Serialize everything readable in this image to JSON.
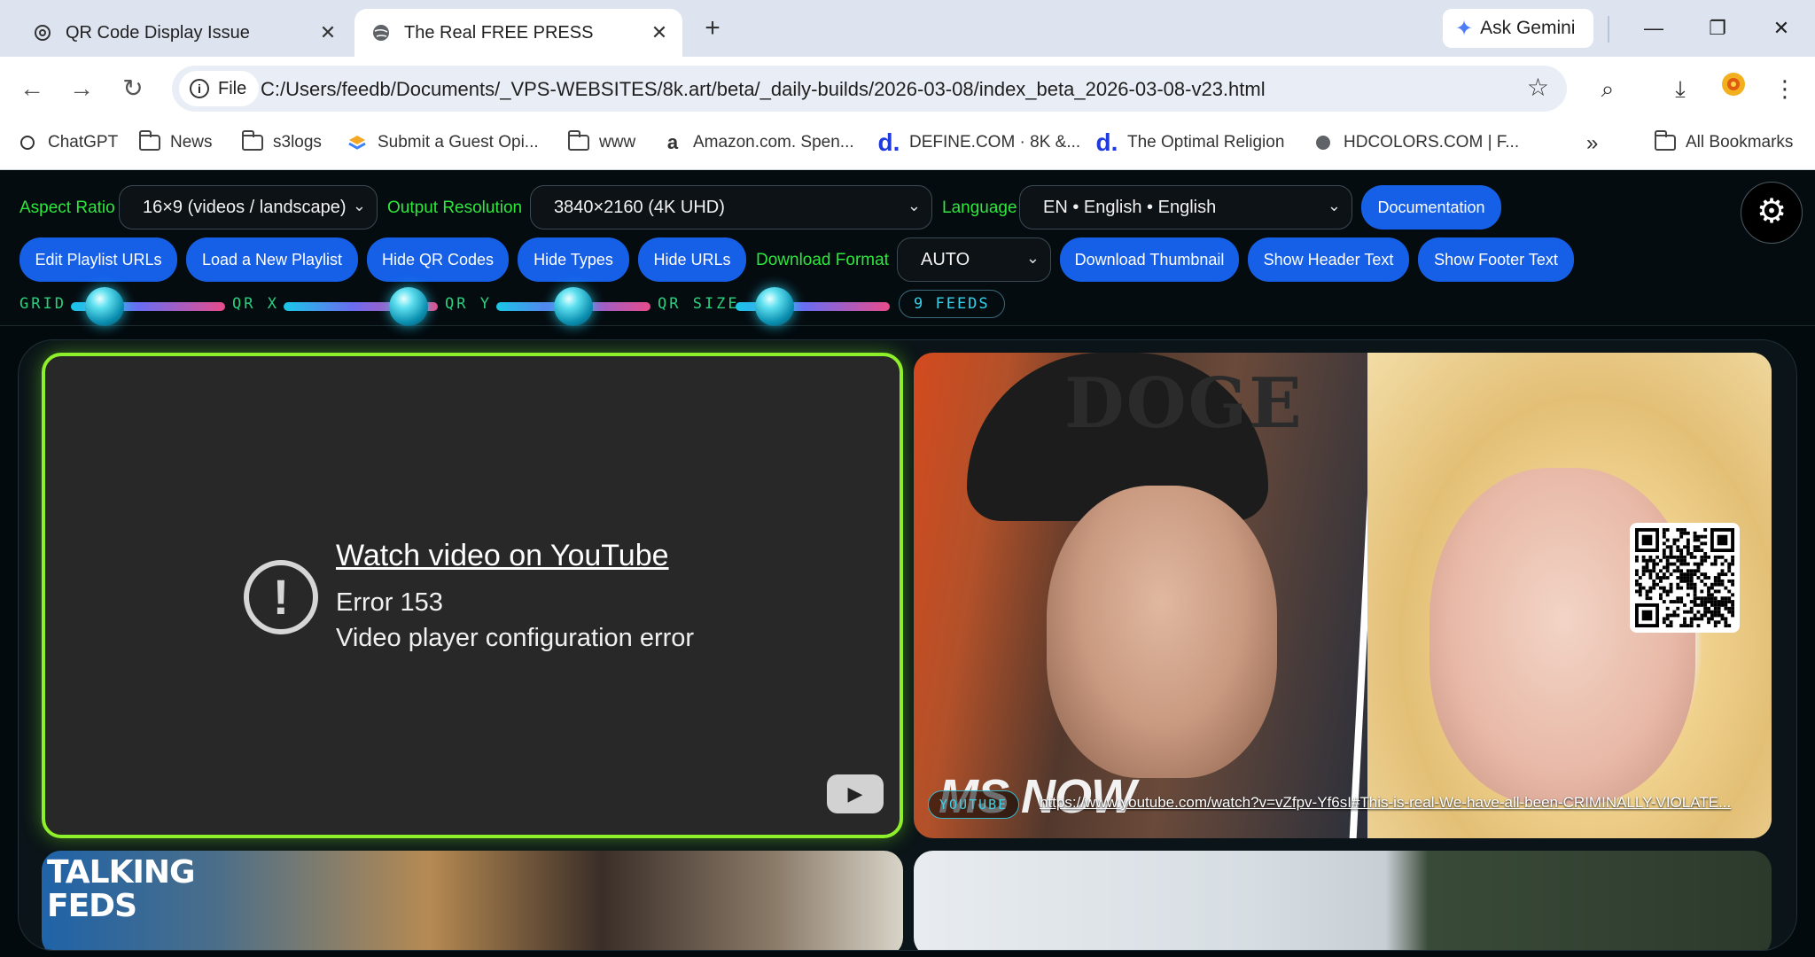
{
  "browser": {
    "tabs": [
      {
        "title": "QR Code Display Issue",
        "icon": "chatgpt-icon",
        "active": false
      },
      {
        "title": "The Real FREE PRESS",
        "icon": "globe-icon",
        "active": true
      }
    ],
    "new_tab_label": "+",
    "ask_gemini_label": "Ask Gemini",
    "url_chip_label": "File",
    "url": "C:/Users/feedb/Documents/_VPS-WEBSITES/8k.art/beta/_daily-builds/2026-03-08/index_beta_2026-03-08-v23.html",
    "bookmarks": [
      {
        "label": "ChatGPT",
        "icon": "chatgpt-icon"
      },
      {
        "label": "News",
        "icon": "folder-icon"
      },
      {
        "label": "s3logs",
        "icon": "folder-icon"
      },
      {
        "label": "Submit a Guest Opi...",
        "icon": "colorful-logo-icon"
      },
      {
        "label": "www",
        "icon": "folder-icon"
      },
      {
        "label": "Amazon.com. Spen...",
        "icon": "amazon-icon"
      },
      {
        "label": "DEFINE.COM · 8K &...",
        "icon": "define-d-icon"
      },
      {
        "label": "The Optimal Religion",
        "icon": "define-d-icon"
      },
      {
        "label": "HDCOLORS.COM | F...",
        "icon": "globe-icon"
      }
    ],
    "overflow_label": "»",
    "all_bookmarks_label": "All Bookmarks"
  },
  "controls": {
    "aspect_ratio_label": "Aspect Ratio",
    "aspect_ratio_value": "16×9 (videos / landscape)",
    "output_resolution_label": "Output Resolution",
    "output_resolution_value": "3840×2160 (4K UHD)",
    "language_label": "Language",
    "language_value": "EN • English • English",
    "documentation_label": "Documentation",
    "buttons": {
      "edit_playlist": "Edit Playlist URLs",
      "load_playlist": "Load a New Playlist",
      "hide_qr": "Hide QR Codes",
      "hide_types": "Hide Types",
      "hide_urls": "Hide URLs",
      "download_thumbnail": "Download Thumbnail",
      "show_header": "Show Header Text",
      "show_footer": "Show Footer Text"
    },
    "download_format_label": "Download Format",
    "download_format_value": "AUTO",
    "sliders": {
      "grid": {
        "label": "GRID",
        "level": 0.22
      },
      "qr_x": {
        "label": "QR X",
        "level": 0.81
      },
      "qr_y": {
        "label": "QR Y",
        "level": 0.5
      },
      "qr_size": {
        "label": "QR SIZE",
        "level": 0.25
      }
    },
    "feeds_badge": "9 FEEDS"
  },
  "feed": {
    "cell1": {
      "link_text": "Watch video on YouTube",
      "error_code": "Error 153",
      "error_message": "Video player configuration error"
    },
    "cell2": {
      "cap_text": "DOGE",
      "network_logo": "MS NOW",
      "source_type": "YOUTUBE",
      "url": "https://www.youtube.com/watch?v=vZfpv-Yf6sI#This-is-real-We-have-all-been-CRIMINALLY-VIOLATE..."
    },
    "cell3": {
      "logo_line1": "TALKING",
      "logo_line2": "FEDS"
    }
  },
  "colors": {
    "accent_green": "#2ee63c",
    "button_blue": "#1660e8",
    "active_cell_border": "#8ef02a",
    "badge_cyan": "#3fd0e6"
  }
}
